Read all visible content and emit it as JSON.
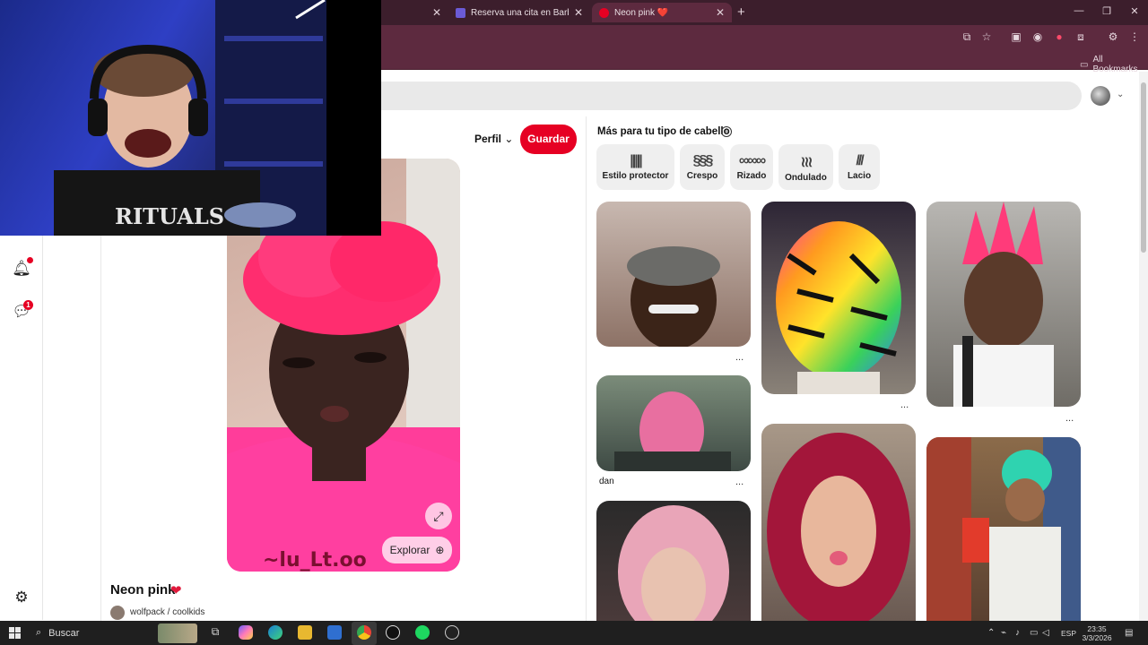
{
  "browser": {
    "tabs": [
      {
        "label": "",
        "active": false
      },
      {
        "label": "Reserva una cita en Barbería De",
        "active": false
      },
      {
        "label": "Neon pink ❤️",
        "active": true
      }
    ],
    "new_tab": "+",
    "bookmarks_label": "All Bookmarks",
    "window_controls": {
      "minimize": "—",
      "restore": "❐",
      "close": "✕"
    }
  },
  "pin": {
    "profile_label": "Perfil",
    "save_label": "Guardar",
    "title": "Neon pink",
    "title_icon": "heart-icon",
    "board": "wolfpack / coolkids",
    "explore_label": "Explorar"
  },
  "related": {
    "title": "Más para tu tipo de cabello",
    "chips": [
      {
        "label": "Estilo protector",
        "icon": "braids-icon"
      },
      {
        "label": "Crespo",
        "icon": "coily-icon"
      },
      {
        "label": "Rizado",
        "icon": "curly-icon"
      },
      {
        "label": "Ondulado",
        "icon": "wavy-icon"
      },
      {
        "label": "Lacio",
        "icon": "straight-icon"
      }
    ],
    "tiles": [
      {
        "caption": ""
      },
      {
        "caption": "dan"
      },
      {
        "caption": ""
      },
      {
        "caption": ""
      },
      {
        "caption": ""
      },
      {
        "caption": ""
      },
      {
        "caption": ""
      }
    ],
    "more_label": "..."
  },
  "sidebar": {
    "notification_badge": "",
    "messages_badge": "1"
  },
  "taskbar": {
    "search_placeholder": "Buscar",
    "language": "ESP",
    "time": "23:35",
    "date": "3/3/2026"
  },
  "colors": {
    "pinterest_red": "#e60023",
    "chrome_theme": "#5d2a3f",
    "tabstrip": "#3c1e2c"
  }
}
